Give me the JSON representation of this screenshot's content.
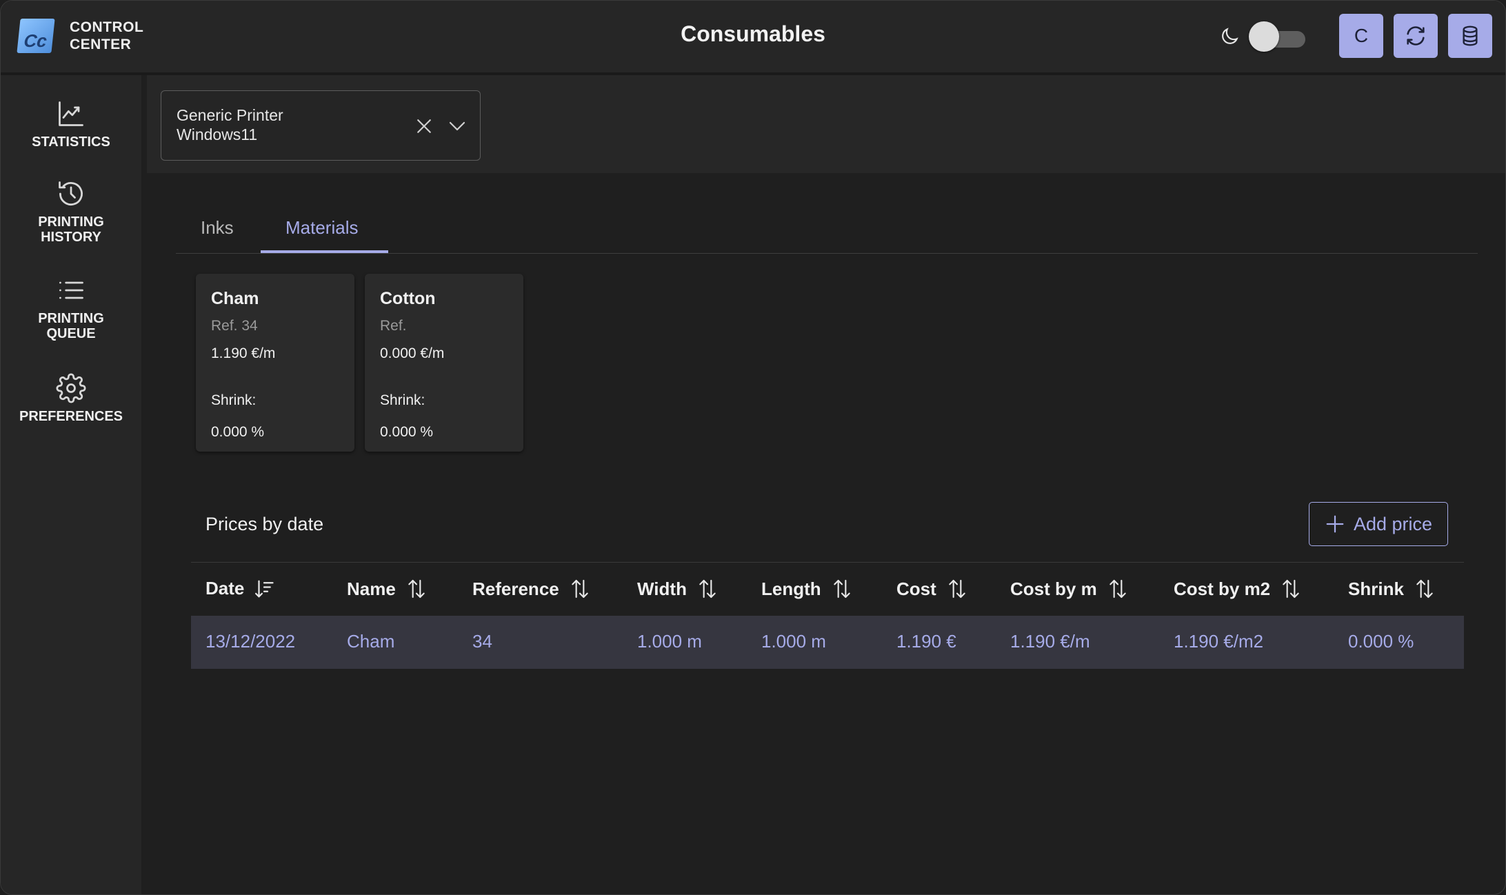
{
  "app": {
    "logo_text": "Cc",
    "brand_line1": "CONTROL",
    "brand_line2": "CENTER",
    "page_title": "Consumables",
    "theme_toggle": "off",
    "user_initial": "C"
  },
  "icons": {
    "theme": "moon-icon",
    "refresh": "refresh-icon",
    "database": "database-icon",
    "statistics": "chart-line-icon",
    "history": "history-icon",
    "queue": "list-icon",
    "preferences": "gear-icon",
    "clear": "close-icon",
    "dropdown": "chevron-down-icon",
    "sort_active": "sort-desc-icon",
    "sort": "sort-icon",
    "add": "plus-icon"
  },
  "colors": {
    "accent": "#a6abe8",
    "background": "#1f1f1f",
    "panel": "#262626",
    "row_highlight": "#363640"
  },
  "sidebar": {
    "items": [
      {
        "line1": "STATISTICS",
        "line2": ""
      },
      {
        "line1": "PRINTING",
        "line2": "HISTORY"
      },
      {
        "line1": "PRINTING",
        "line2": "QUEUE"
      },
      {
        "line1": "PREFERENCES",
        "line2": ""
      }
    ]
  },
  "printer": {
    "line1": "Generic Printer",
    "line2": "Windows11"
  },
  "tabs": [
    {
      "label": "Inks",
      "active": false
    },
    {
      "label": "Materials",
      "active": true
    }
  ],
  "materials": [
    {
      "name": "Cham",
      "ref": "Ref. 34",
      "price": "1.190 €/m",
      "shrink_label": "Shrink:",
      "shrink": "0.000 %"
    },
    {
      "name": "Cotton",
      "ref": "Ref.",
      "price": "0.000 €/m",
      "shrink_label": "Shrink:",
      "shrink": "0.000 %"
    }
  ],
  "prices": {
    "title": "Prices by date",
    "add_label": "Add price",
    "columns": [
      "Date",
      "Name",
      "Reference",
      "Width",
      "Length",
      "Cost",
      "Cost by m",
      "Cost by m2",
      "Shrink"
    ],
    "rows": [
      [
        "13/12/2022",
        "Cham",
        "34",
        "1.000 m",
        "1.000 m",
        "1.190 €",
        "1.190 €/m",
        "1.190 €/m2",
        "0.000 %"
      ]
    ]
  }
}
